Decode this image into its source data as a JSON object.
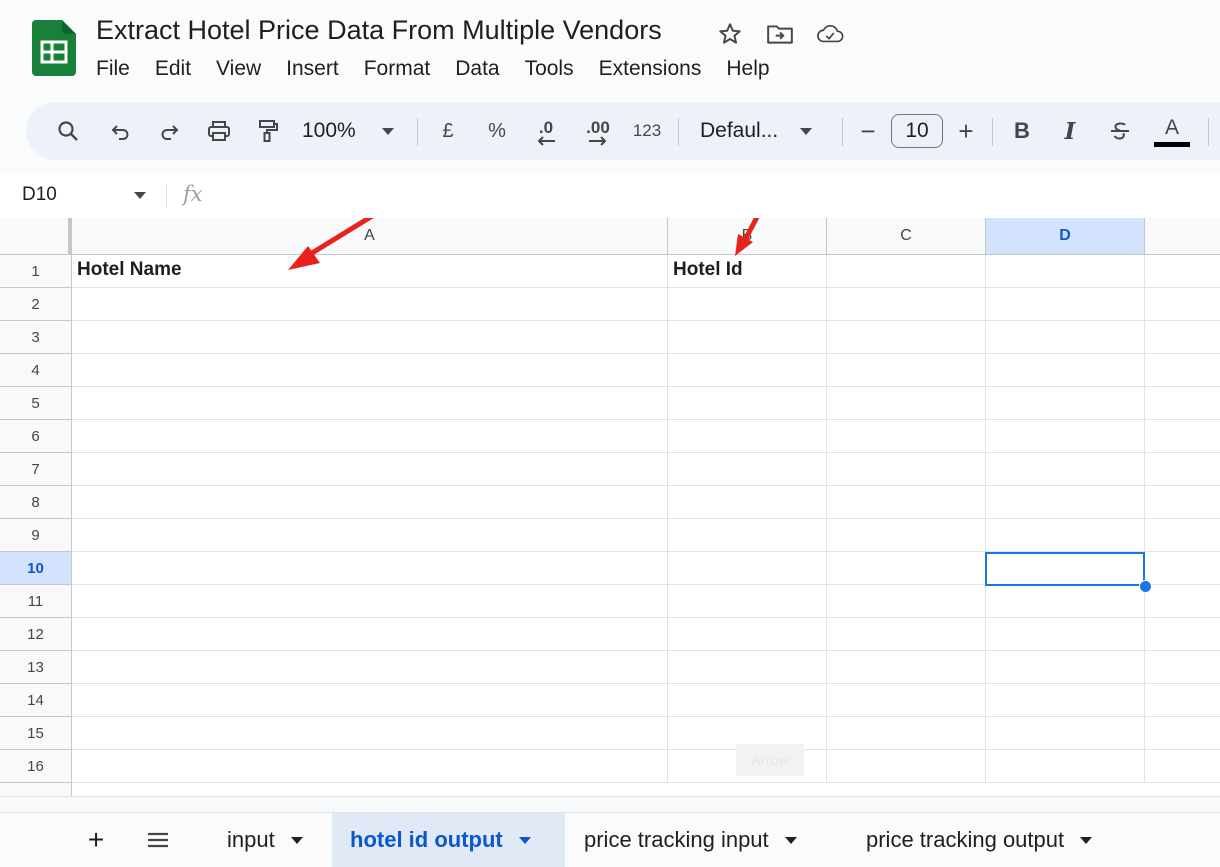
{
  "document": {
    "title": "Extract Hotel Price Data From Multiple Vendors"
  },
  "menu": [
    "File",
    "Edit",
    "View",
    "Insert",
    "Format",
    "Data",
    "Tools",
    "Extensions",
    "Help"
  ],
  "toolbar": {
    "zoom": "100%",
    "currency": "£",
    "percent": "%",
    "decrease_decimal": ".0",
    "increase_decimal": ".00",
    "number_format": "123",
    "font": "Defaul...",
    "font_size": "10",
    "minus": "−",
    "plus": "+",
    "bold": "B",
    "italic": "I",
    "text_color": "A"
  },
  "formula_bar": {
    "name_box": "D10",
    "fx": "fx"
  },
  "grid": {
    "columns": [
      "A",
      "B",
      "C",
      "D"
    ],
    "selected_column": "D",
    "rows": [
      "1",
      "2",
      "3",
      "4",
      "5",
      "6",
      "7",
      "8",
      "9",
      "10",
      "11",
      "12",
      "13",
      "14",
      "15",
      "16"
    ],
    "selected_row": "10",
    "cells": {
      "A1": "Hotel Name",
      "B1": "Hotel Id"
    },
    "watermark": "Arrow"
  },
  "sheet_tabs": {
    "add": "+",
    "list": "☰",
    "tabs": [
      {
        "label": "input",
        "active": false
      },
      {
        "label": "hotel id output",
        "active": true
      },
      {
        "label": "price tracking input",
        "active": false
      },
      {
        "label": "price tracking output",
        "active": false
      }
    ]
  },
  "colors": {
    "accent": "#0b57d0",
    "selection": "#1a73e8",
    "sheets_green": "#188038",
    "annotation_arrow": "#e8231c"
  }
}
